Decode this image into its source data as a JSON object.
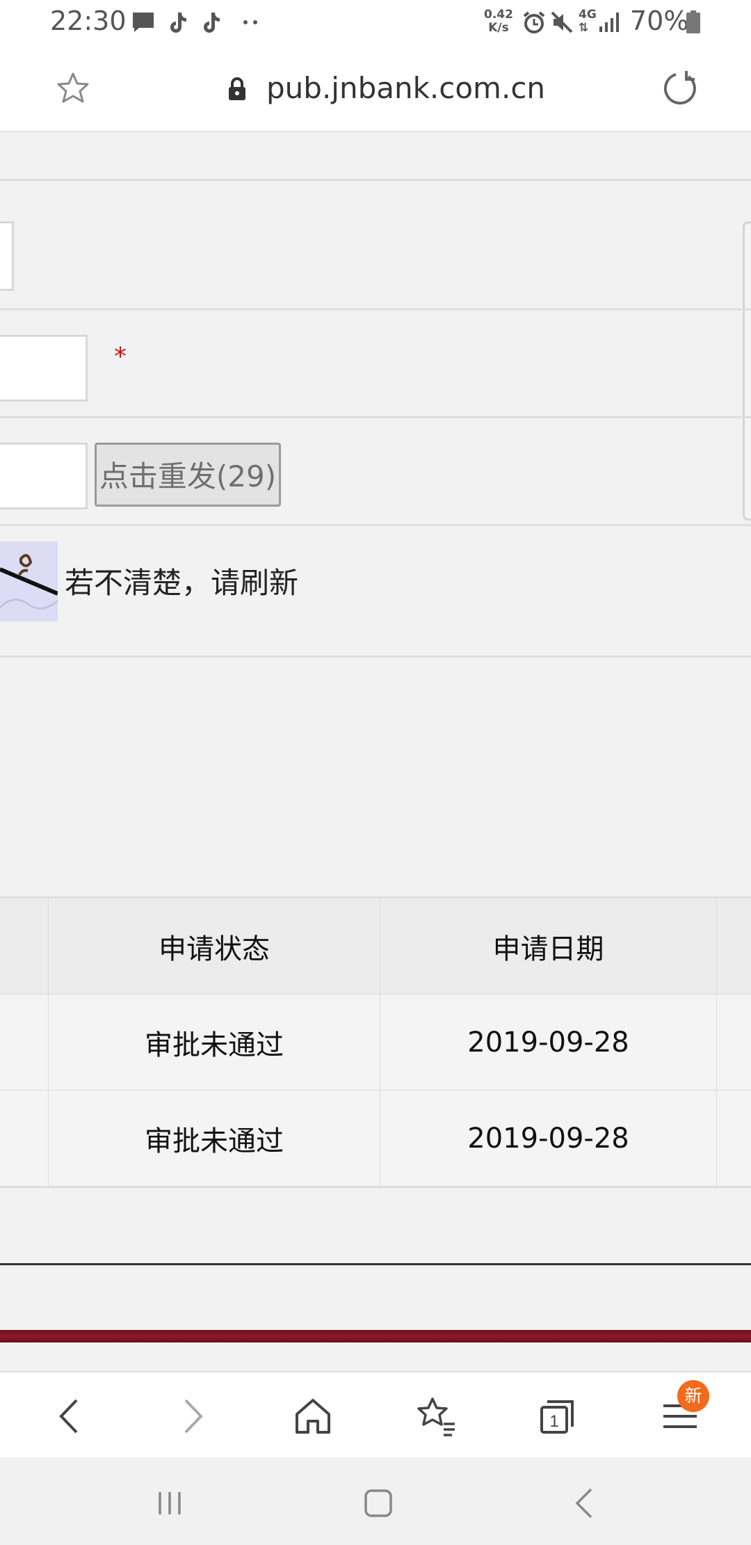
{
  "status_bar": {
    "time": "22:30",
    "net_speed_value": "0.42",
    "net_speed_unit": "K/s",
    "network": "4G",
    "battery": "70%",
    "icons": [
      "chat-icon",
      "tiktok-icon",
      "tiktok-icon",
      "more-dots-icon",
      "alarm-icon",
      "mute-icon",
      "signal-icon",
      "battery-icon"
    ]
  },
  "address_bar": {
    "url": "pub.jnbank.com.cn",
    "icons": [
      "bookmark-star-icon",
      "lock-icon",
      "reload-icon"
    ]
  },
  "form": {
    "required_mark": "*",
    "resend_button_label": "点击重发(29)",
    "captcha_hint": "若不清楚，请刷新"
  },
  "table": {
    "headers": [
      "申请状态",
      "申请日期"
    ],
    "rows": [
      {
        "status": "审批未通过",
        "date": "2019-09-28"
      },
      {
        "status": "审批未通过",
        "date": "2019-09-28"
      }
    ]
  },
  "browser_toolbar": {
    "buttons": [
      "back",
      "forward",
      "home",
      "bookmarks",
      "tabs",
      "menu"
    ],
    "tab_count": "1",
    "menu_badge": "新"
  },
  "colors": {
    "required": "#cc1111",
    "footer_band": "#8d1a28",
    "badge": "#f26a1b"
  }
}
